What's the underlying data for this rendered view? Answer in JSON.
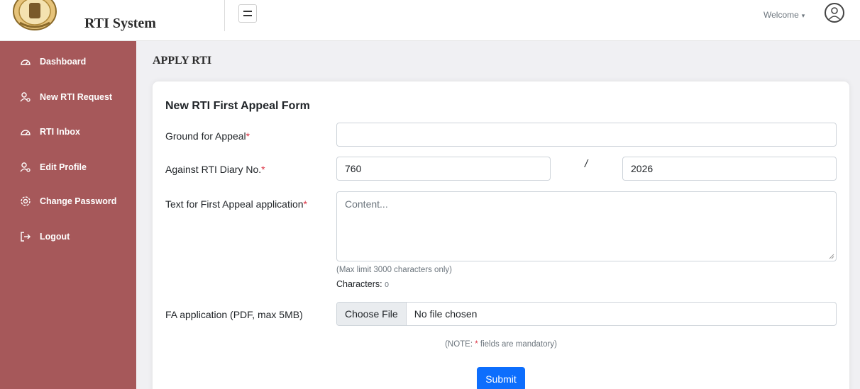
{
  "header": {
    "brand_title": "RTI System",
    "welcome_label": "Welcome",
    "caret": "▾"
  },
  "sidebar": {
    "items": [
      {
        "label": "Dashboard",
        "icon": "dashboard-icon"
      },
      {
        "label": "New RTI Request",
        "icon": "user-gear-icon"
      },
      {
        "label": "RTI Inbox",
        "icon": "inbox-icon"
      },
      {
        "label": "Edit Profile",
        "icon": "user-gear-icon"
      },
      {
        "label": "Change Password",
        "icon": "gear-icon"
      },
      {
        "label": "Logout",
        "icon": "logout-icon"
      }
    ]
  },
  "main": {
    "page_title": "APPLY RTI",
    "form": {
      "title": "New RTI First Appeal Form",
      "required_mark": "*",
      "ground_label": "Ground for Appeal",
      "ground_value": "",
      "diary_label": "Against RTI Diary No.",
      "diary_no": "760",
      "diary_separator": "/",
      "diary_year": "2026",
      "text_label": "Text for First Appeal application",
      "text_placeholder": "Content...",
      "max_hint": "(Max limit 3000 characters only)",
      "characters_label": "Characters:",
      "characters_count": "0",
      "file_label": "FA application (PDF, max 5MB)",
      "file_button": "Choose File",
      "file_status": "No file chosen",
      "note_prefix": "(NOTE: ",
      "note_star": "*",
      "note_suffix": " fields are mandatory)",
      "submit_label": "Submit"
    }
  },
  "colors": {
    "sidebar": "#a6585a",
    "primary": "#0d6efd",
    "required": "#dc3545"
  }
}
